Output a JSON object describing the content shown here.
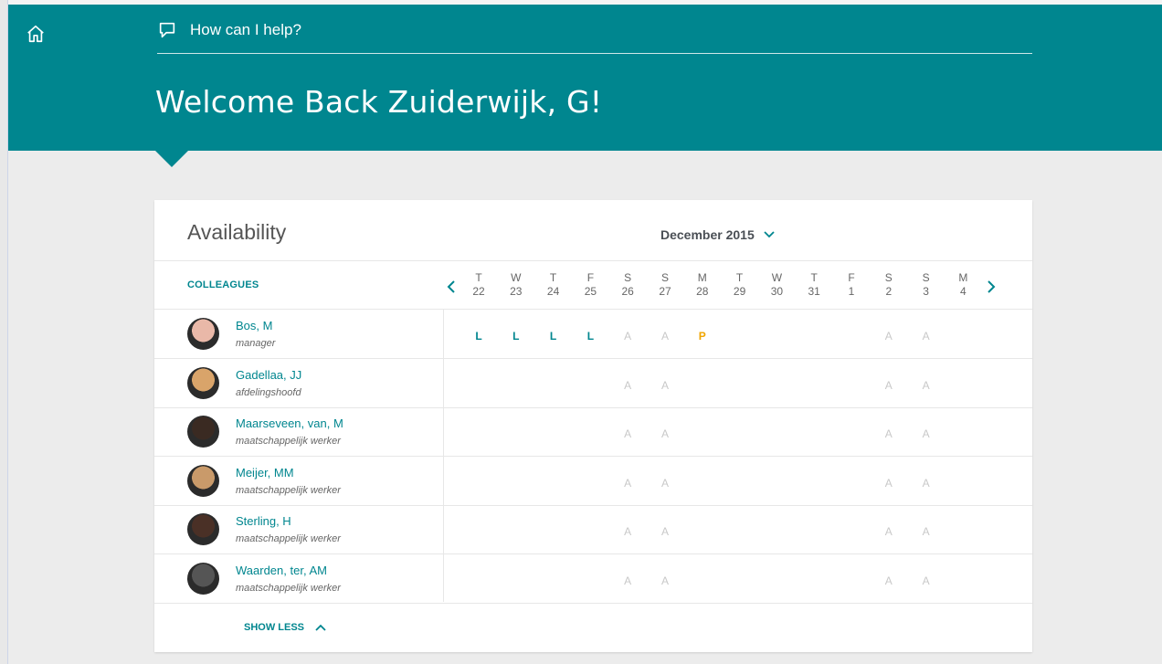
{
  "header": {
    "help_placeholder": "How can I help?",
    "welcome": "Welcome Back Zuiderwijk, G!"
  },
  "availability": {
    "title": "Availability",
    "month": "December 2015",
    "colleagues_header": "COLLEAGUES",
    "days": [
      {
        "w": "T",
        "d": "22"
      },
      {
        "w": "W",
        "d": "23"
      },
      {
        "w": "T",
        "d": "24"
      },
      {
        "w": "F",
        "d": "25"
      },
      {
        "w": "S",
        "d": "26"
      },
      {
        "w": "S",
        "d": "27"
      },
      {
        "w": "M",
        "d": "28"
      },
      {
        "w": "T",
        "d": "29"
      },
      {
        "w": "W",
        "d": "30"
      },
      {
        "w": "T",
        "d": "31"
      },
      {
        "w": "F",
        "d": "1"
      },
      {
        "w": "S",
        "d": "2"
      },
      {
        "w": "S",
        "d": "3"
      },
      {
        "w": "M",
        "d": "4"
      }
    ],
    "colleagues": [
      {
        "name": "Bos, M",
        "role": "manager",
        "cells": [
          "L",
          "L",
          "L",
          "L",
          "A",
          "A",
          "P",
          "",
          "",
          "",
          "",
          "A",
          "A",
          ""
        ]
      },
      {
        "name": "Gadellaa, JJ",
        "role": "afdelingshoofd",
        "cells": [
          "",
          "",
          "",
          "",
          "A",
          "A",
          "",
          "",
          "",
          "",
          "",
          "A",
          "A",
          ""
        ]
      },
      {
        "name": "Maarseveen, van, M",
        "role": "maatschappelijk werker",
        "cells": [
          "",
          "",
          "",
          "",
          "A",
          "A",
          "",
          "",
          "",
          "",
          "",
          "A",
          "A",
          ""
        ]
      },
      {
        "name": "Meijer, MM",
        "role": "maatschappelijk werker",
        "cells": [
          "",
          "",
          "",
          "",
          "A",
          "A",
          "",
          "",
          "",
          "",
          "",
          "A",
          "A",
          ""
        ]
      },
      {
        "name": "Sterling, H",
        "role": "maatschappelijk werker",
        "cells": [
          "",
          "",
          "",
          "",
          "A",
          "A",
          "",
          "",
          "",
          "",
          "",
          "A",
          "A",
          ""
        ]
      },
      {
        "name": "Waarden, ter, AM",
        "role": "maatschappelijk werker",
        "cells": [
          "",
          "",
          "",
          "",
          "A",
          "A",
          "",
          "",
          "",
          "",
          "",
          "A",
          "A",
          ""
        ]
      }
    ],
    "show_less": "SHOW LESS"
  },
  "colors": {
    "brand": "#00868f",
    "leave": "#00868f",
    "absent": "#c8c8c8",
    "pending": "#f0a500"
  },
  "icons": {
    "home": "home-icon",
    "help": "chat-bubble-icon",
    "month": "chevron-down-icon",
    "prev": "chevron-left-icon",
    "next": "chevron-right-icon",
    "less": "chevron-up-icon"
  }
}
